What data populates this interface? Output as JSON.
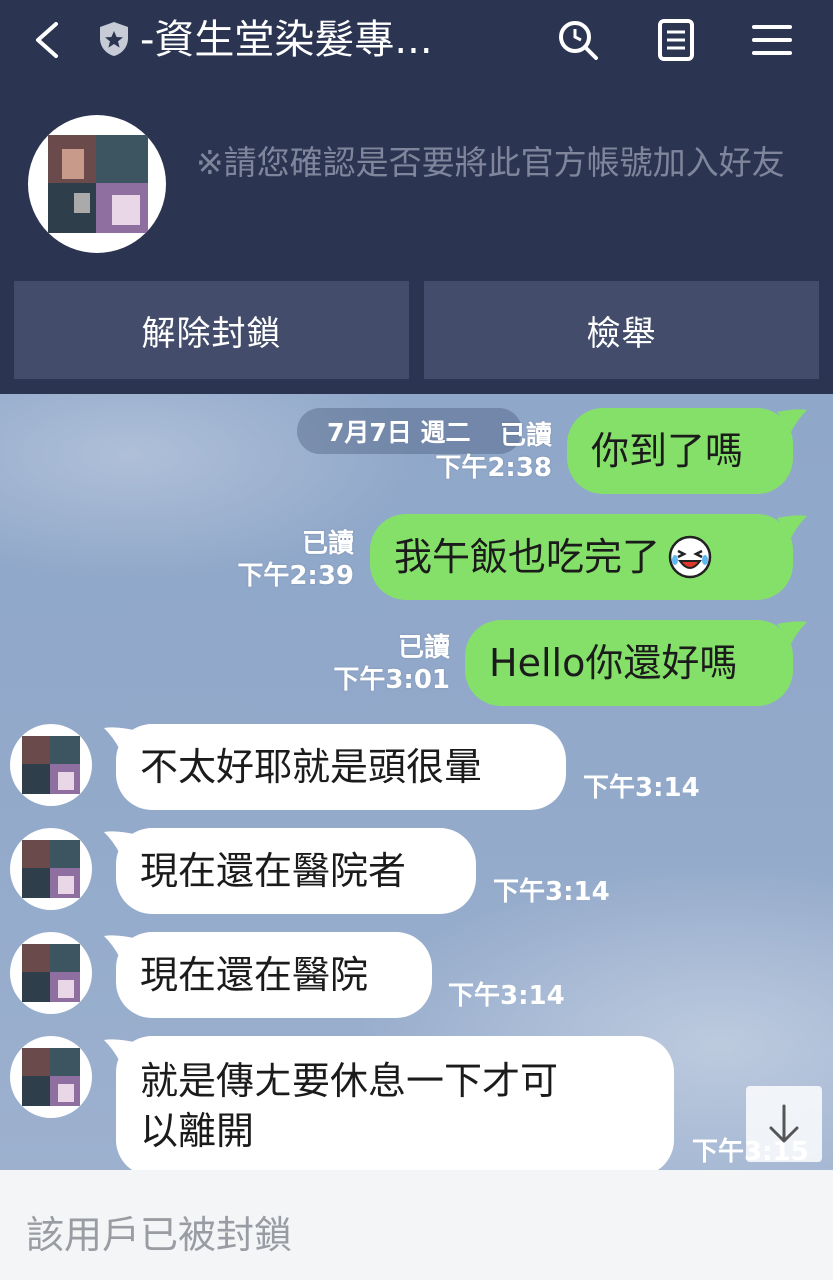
{
  "header": {
    "title": "-資生堂染髮專...",
    "back_icon": "chevron-left-icon",
    "shield_icon": "shield-star-icon",
    "actions": [
      "search-icon",
      "notes-icon",
      "menu-icon"
    ],
    "notice": "※請您確認是否要將此官方帳號加入好友",
    "buttons": {
      "unblock": "解除封鎖",
      "report": "檢舉"
    }
  },
  "chat": {
    "date": "7月7日 週二",
    "messages": [
      {
        "from": "me",
        "text": "你到了嗎",
        "read": "已讀",
        "time": "下午2:38"
      },
      {
        "from": "me",
        "text": "我午飯也吃完了",
        "read": "已讀",
        "time": "下午2:39",
        "emoji": "laughing-crying-face-icon"
      },
      {
        "from": "me",
        "text": "Hello你還好嗎",
        "read": "已讀",
        "time": "下午3:01"
      },
      {
        "from": "them",
        "text": "不太好耶就是頭很暈",
        "time": "下午3:14"
      },
      {
        "from": "them",
        "text": "現在還在醫院者",
        "time": "下午3:14"
      },
      {
        "from": "them",
        "text": "現在還在醫院",
        "time": "下午3:14"
      },
      {
        "from": "them",
        "text_line1": "就是傳ㄤ要休息一下才可",
        "text_line2": "以離開",
        "time": "下午3:15"
      }
    ],
    "scroll_icon": "arrow-down-icon"
  },
  "footer": {
    "blocked_text": "該用戶已被封鎖"
  },
  "colors": {
    "header_bg": "#2b3451",
    "my_bubble": "#85e06a",
    "their_bubble": "#ffffff",
    "chat_bg": "#8fa7c9"
  }
}
